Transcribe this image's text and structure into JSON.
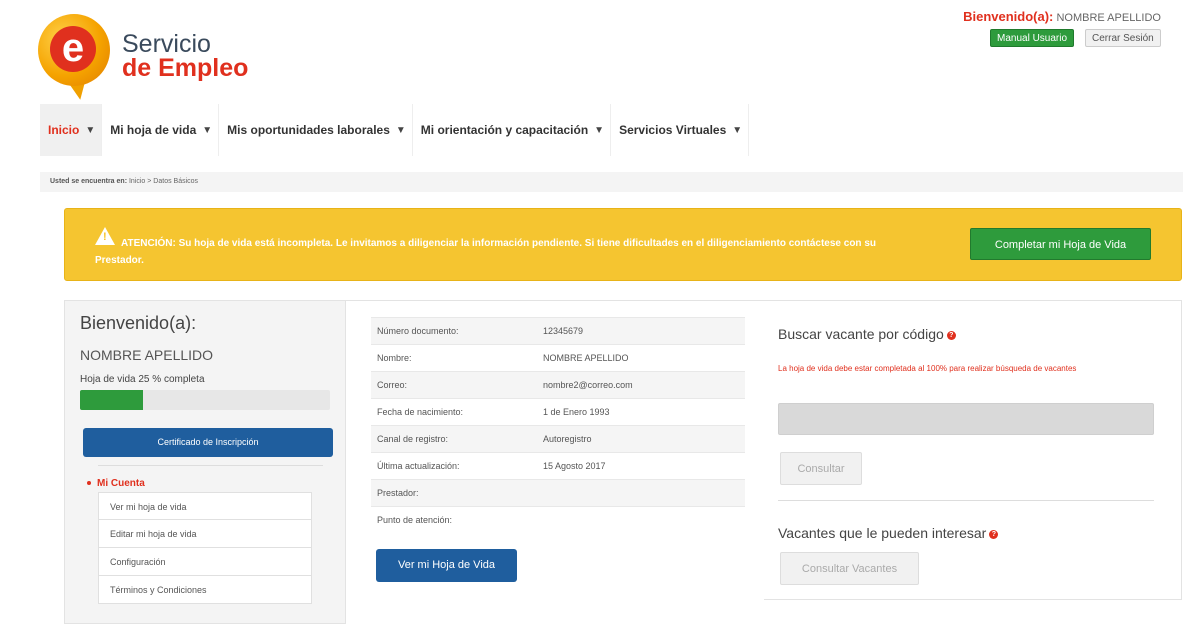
{
  "brand": {
    "line1": "Servicio",
    "line2": "de Empleo",
    "logo_letter": "e"
  },
  "header": {
    "welcome_label": "Bienvenido(a):",
    "user_name": "NOMBRE APELLIDO",
    "manual_button": "Manual Usuario",
    "logout_button": "Cerrar Sesión"
  },
  "nav": {
    "items": [
      {
        "label": "Inicio"
      },
      {
        "label": "Mi hoja de vida"
      },
      {
        "label": "Mis oportunidades laborales"
      },
      {
        "label": "Mi orientación y capacitación"
      },
      {
        "label": "Servicios Virtuales"
      }
    ]
  },
  "breadcrumb": {
    "prefix": "Usted se encuentra en:",
    "path": "Inicio > Datos Básicos"
  },
  "alert": {
    "text": "ATENCIÓN: Su hoja de vida está incompleta. Le invitamos a diligenciar la información pendiente. Si tiene dificultades en el diligenciamiento contáctese con su Prestador.",
    "button": "Completar mi Hoja de Vida"
  },
  "profile": {
    "greeting": "Bienvenido(a):",
    "name": "NOMBRE APELLIDO",
    "progress_label": "Hoja de vida 25 % completa",
    "progress_percent": 25,
    "certificate_button": "Certificado de Inscripción",
    "account_title": "Mi Cuenta",
    "menu": [
      {
        "label": "Ver mi hoja de vida"
      },
      {
        "label": "Editar mi hoja de vida"
      },
      {
        "label": "Configuración"
      },
      {
        "label": "Términos y Condiciones"
      }
    ]
  },
  "info": {
    "rows": [
      {
        "key": "Número documento:",
        "value": "12345679"
      },
      {
        "key": "Nombre:",
        "value": "NOMBRE APELLIDO"
      },
      {
        "key": "Correo:",
        "value": "nombre2@correo.com"
      },
      {
        "key": "Fecha de nacimiento:",
        "value": "1 de Enero 1993"
      },
      {
        "key": "Canal de registro:",
        "value": "Autoregistro"
      },
      {
        "key": "Última actualización:",
        "value": "15 Agosto 2017"
      },
      {
        "key": "Prestador:",
        "value": ""
      },
      {
        "key": "Punto de atención:",
        "value": ""
      }
    ],
    "view_button": "Ver mi Hoja de Vida"
  },
  "search": {
    "title": "Buscar vacante por código",
    "warning": "La hoja de vida debe estar completada al 100% para realizar búsqueda de vacantes",
    "input_value": "",
    "consult_button": "Consultar",
    "suggest_title": "Vacantes que le pueden interesar",
    "suggest_button": "Consultar Vacantes"
  },
  "colors": {
    "accent_red": "#e0301e",
    "green": "#2e9b3c",
    "blue": "#1f5e9e",
    "alert_yellow": "#f5c530"
  }
}
